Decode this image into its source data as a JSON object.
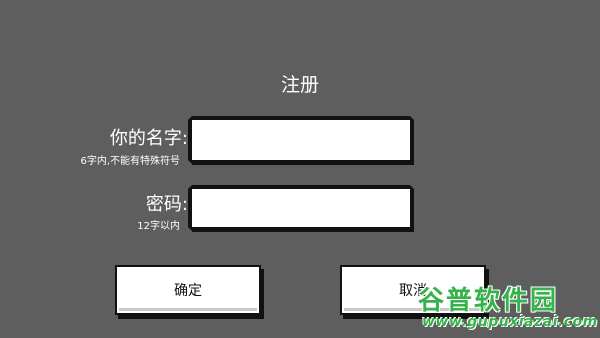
{
  "dialog": {
    "title": "注册",
    "name_label": "你的名字:",
    "name_hint": "6字内,不能有特殊符号",
    "name_value": "",
    "password_label": "密码:",
    "password_hint": "12字以内",
    "password_value": "",
    "confirm_label": "确定",
    "cancel_label": "取消"
  },
  "watermark": {
    "main": "谷普软件园",
    "url": "www.gupuxiazai.com"
  },
  "colors": {
    "background": "#5e5e5e",
    "field": "#ffffff",
    "frame": "#111111",
    "watermark": "#35b34a"
  }
}
